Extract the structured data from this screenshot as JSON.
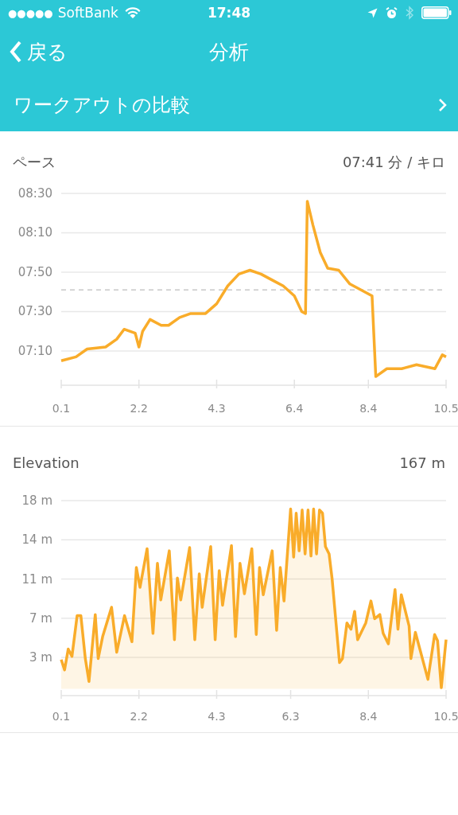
{
  "status_bar": {
    "signal": "●●●●●",
    "carrier": "SoftBank",
    "time": "17:48"
  },
  "nav": {
    "back": "戻る",
    "title": "分析"
  },
  "compare_row": {
    "label": "ワークアウトの比較"
  },
  "sections": [
    {
      "title": "ペース",
      "value": "07:41 分 / キロ",
      "chart_data": {
        "type": "line",
        "x": [
          0.1,
          0.5,
          0.8,
          1.3,
          1.6,
          1.8,
          2.1,
          2.2,
          2.3,
          2.5,
          2.8,
          3.0,
          3.3,
          3.6,
          4.0,
          4.3,
          4.6,
          4.9,
          5.2,
          5.5,
          5.8,
          6.1,
          6.4,
          6.6,
          6.7,
          6.75,
          6.9,
          7.1,
          7.3,
          7.6,
          7.9,
          8.2,
          8.5,
          8.6,
          8.9,
          9.3,
          9.7,
          10.2,
          10.4,
          10.5
        ],
        "series": [
          {
            "color": "#f9ac2a",
            "values": [
              425,
              427,
              431,
              432,
              436,
              441,
              439,
              432,
              440,
              446,
              443,
              443,
              447,
              449,
              449,
              454,
              463,
              469,
              471,
              469,
              466,
              463,
              458,
              450,
              449,
              506,
              494,
              480,
              472,
              471,
              464,
              461,
              458,
              417,
              421,
              421,
              423,
              421,
              428,
              427
            ]
          }
        ],
        "xlim": [
          0.1,
          10.5
        ],
        "ylim": [
          412.6,
          510
        ],
        "grid": true,
        "xticks": [
          0.1,
          2.2,
          4.3,
          6.4,
          8.4,
          10.5
        ],
        "yticks": [
          {
            "value": 430,
            "label": "07:10"
          },
          {
            "value": 450,
            "label": "07:30"
          },
          {
            "value": 470,
            "label": "07:50"
          },
          {
            "value": 490,
            "label": "08:10"
          },
          {
            "value": 510,
            "label": "08:30"
          }
        ],
        "ref_lines": [
          {
            "axis": "y",
            "value": 461
          }
        ]
      }
    },
    {
      "title": "Elevation",
      "value": "167 m",
      "chart_data": {
        "type": "area",
        "x": [
          0.1,
          0.19,
          0.29,
          0.39,
          0.53,
          0.63,
          0.75,
          0.85,
          1.02,
          1.1,
          1.22,
          1.46,
          1.6,
          1.81,
          2.01,
          2.13,
          2.23,
          2.42,
          2.58,
          2.7,
          2.79,
          3.02,
          3.16,
          3.24,
          3.33,
          3.57,
          3.71,
          3.83,
          3.91,
          4.14,
          4.26,
          4.37,
          4.46,
          4.7,
          4.81,
          4.93,
          5.05,
          5.25,
          5.37,
          5.46,
          5.56,
          5.8,
          5.92,
          6.02,
          6.12,
          6.3,
          6.38,
          6.45,
          6.53,
          6.61,
          6.69,
          6.77,
          6.85,
          6.92,
          7.0,
          7.08,
          7.16,
          7.24,
          7.34,
          7.42,
          7.62,
          7.7,
          7.82,
          7.93,
          8.03,
          8.11,
          8.33,
          8.47,
          8.57,
          8.71,
          8.8,
          8.94,
          9.12,
          9.2,
          9.29,
          9.5,
          9.55,
          9.67,
          10.01,
          10.19,
          10.27,
          10.37,
          10.5
        ],
        "series": [
          {
            "color": "#f9ac2a",
            "values": [
              2.8,
              1.8,
              3.8,
              3.1,
              7.0,
              7.0,
              2.9,
              0.7,
              7.1,
              2.9,
              5.0,
              7.8,
              3.5,
              7.0,
              4.5,
              11.6,
              9.7,
              13.4,
              5.3,
              12.0,
              8.5,
              13.2,
              4.7,
              10.6,
              8.5,
              13.5,
              4.7,
              11.0,
              7.8,
              13.6,
              4.7,
              11.3,
              8.0,
              13.7,
              5.0,
              12.0,
              9.1,
              13.4,
              5.2,
              11.6,
              9.0,
              13.2,
              5.6,
              11.6,
              8.4,
              17.2,
              12.6,
              16.8,
              13.2,
              17.1,
              12.9,
              17.1,
              12.7,
              17.2,
              12.9,
              17.1,
              16.8,
              13.6,
              12.9,
              10.5,
              2.5,
              2.9,
              6.3,
              5.7,
              7.4,
              4.7,
              6.3,
              8.4,
              6.7,
              7.1,
              5.3,
              4.3,
              9.5,
              5.7,
              9.0,
              6.0,
              2.9,
              5.4,
              0.9,
              5.2,
              4.6,
              0.1,
              4.7
            ]
          }
        ],
        "xlim": [
          0.1,
          10.5
        ],
        "ylim": [
          -0.65,
          18
        ],
        "grid": true,
        "xticks": [
          0.1,
          2.2,
          4.3,
          6.3,
          8.4,
          10.5
        ],
        "yticks": [
          {
            "value": 3,
            "label": "3 m"
          },
          {
            "value": 6.75,
            "label": "7 m"
          },
          {
            "value": 10.5,
            "label": "11 m"
          },
          {
            "value": 14.25,
            "label": "14 m"
          },
          {
            "value": 18,
            "label": "18 m"
          }
        ]
      }
    }
  ]
}
